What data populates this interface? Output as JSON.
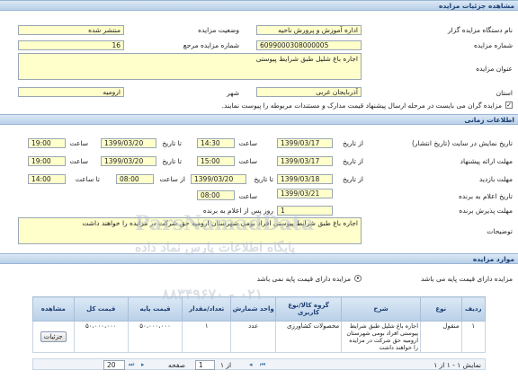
{
  "sections": {
    "details": "مشاهده جزئیات مزایده",
    "timing": "اطلاعات زمانی",
    "items": "موارد مزایده"
  },
  "details": {
    "org_label": "نام دستگاه مزایده گزار",
    "org_value": "اداره آموزش و پرورش ناحیه",
    "status_label": "وضعیت مزایده",
    "status_value": "منتشر شده",
    "auction_no_label": "شماره مزایده",
    "auction_no_value": "6099000308000005",
    "ref_no_label": "شماره مزایده مرجع",
    "ref_no_value": "16",
    "title_label": "عنوان مزایده",
    "title_value": "اجاره باغ شلیل طبق شرایط پیوستی",
    "province_label": "استان",
    "province_value": "آذربایجان غربی",
    "city_label": "شهر",
    "city_value": "ارومیه",
    "checkbox_text": "مزایده گران می بایست در مرحله ارسال پیشنهاد قیمت مدارک و مستندات مربوطه را پیوست نمایند."
  },
  "timing": {
    "publish_label": "تاریخ نمایش در سایت (تاریخ انتشار)",
    "publish_from_label": "از تاریخ",
    "publish_from": "1399/03/17",
    "publish_from_time_label": "ساعت",
    "publish_from_time": "14:30",
    "publish_to_label": "تا تاریخ",
    "publish_to": "1399/03/20",
    "publish_to_time_label": "ساعت",
    "publish_to_time": "19:00",
    "offer_label": "مهلت ارائه پیشنهاد",
    "offer_from_label": "از تاریخ",
    "offer_from": "1399/03/17",
    "offer_from_time_label": "ساعت",
    "offer_from_time": "15:00",
    "offer_to_label": "تا تاریخ",
    "offer_to": "1399/03/20",
    "offer_to_time_label": "ساعت",
    "offer_to_time": "19:00",
    "visit_label": "مهلت بازدید",
    "visit_from_label": "از تاریخ",
    "visit_from": "1399/03/18",
    "visit_to_label": "تا تاریخ",
    "visit_to": "1399/03/20",
    "visit_from_time_label": "از ساعت",
    "visit_from_time": "08:00",
    "visit_to_time_label": "تا ساعت",
    "visit_to_time": "14:00",
    "winner_date_label": "تاریخ اعلام به برنده",
    "winner_date": "1399/03/21",
    "winner_time_label": "ساعت",
    "winner_time": "08:00",
    "accept_label": "مهلت پذیرش برنده",
    "accept_days": "1",
    "accept_suffix": "روز پس از اعلام به برنده",
    "desc_label": "توضیحات",
    "desc_value": "اجاره باغ طبق شرایط پیوستی افراد بومی شهرستان ارومیه حق شرکت در مزایده را خواهند داشت"
  },
  "items": {
    "radio_label": "مزایده دارای قیمت پایه می باشد",
    "radio_text": "مزایده دارای قیمت پایه نمی باشد",
    "columns": [
      "ردیف",
      "نوع",
      "شرح",
      "گروه کالا/نوع کاربری",
      "واحد شمارش",
      "تعداد/مقدار",
      "قیمت پایه",
      "قیمت کل",
      "مشاهده"
    ],
    "rows": [
      {
        "row": "۱",
        "type": "منقول",
        "desc": "اجاره باغ شلیل طبق شرایط پیوستی افراد بومی شهرستان ارومیه حق شرکت در مزایده را خواهند داشت",
        "group": "محصولات کشاورزی",
        "unit": "عدد",
        "qty": "۱",
        "base": "۵۰،۰۰۰،۰۰۰",
        "total": "۵۰،۰۰۰،۰۰۰",
        "view": "جزئیات"
      }
    ],
    "pager_summary": "نمایش ۱ - ۱ از ۱",
    "pager_page_label": "صفحه",
    "pager_page": "1",
    "pager_of": "از ۱",
    "pager_size": "20"
  },
  "watermark": {
    "line1": "ParsNamadData",
    "line2": "پایگاه اطلاعات پارس نماد داده",
    "phone": "۰۲۱ - ۸۸۳۴۹۶۷۰"
  },
  "colors": {
    "section_text": "#1c3e73",
    "field_bg": "#ffffcc",
    "watermark": "#b9c3ce"
  }
}
